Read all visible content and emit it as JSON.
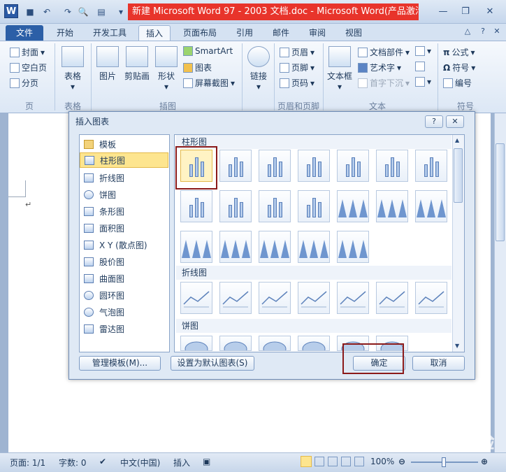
{
  "window": {
    "title": "新建 Microsoft Word 97 - 2003 文档.doc - Microsoft Word(产品激活...",
    "app_icon": "W"
  },
  "tabs": [
    "文件",
    "开始",
    "开发工具",
    "插入",
    "页面布局",
    "引用",
    "邮件",
    "审阅",
    "视图"
  ],
  "active_tab": "插入",
  "ribbon": {
    "pages": {
      "cover": "封面",
      "blank": "空白页",
      "break": "分页",
      "group": "页"
    },
    "table": {
      "label": "表格",
      "group": "表格"
    },
    "illustrations": {
      "picture": "图片",
      "clipart": "剪贴画",
      "shapes": "形状",
      "smartart": "SmartArt",
      "chart": "图表",
      "screenshot": "屏幕截图",
      "group": "插图"
    },
    "links": {
      "label": "链接"
    },
    "header_footer": {
      "header": "页眉",
      "footer": "页脚",
      "page_number": "页码",
      "group": "页眉和页脚"
    },
    "text": {
      "textbox": "文本框",
      "quickparts": "文档部件",
      "wordart": "艺术字",
      "dropcap": "首字下沉",
      "group": "文本"
    },
    "symbols": {
      "equation": "公式",
      "symbol": "符号",
      "numbering": "编号",
      "group": "符号"
    }
  },
  "dialog": {
    "title": "插入图表",
    "help": "?",
    "close": "✕",
    "categories": [
      {
        "label": "模板",
        "icon": "folder-icon"
      },
      {
        "label": "柱形图",
        "icon": "column-chart-icon"
      },
      {
        "label": "折线图",
        "icon": "line-chart-icon"
      },
      {
        "label": "饼图",
        "icon": "pie-chart-icon"
      },
      {
        "label": "条形图",
        "icon": "bar-chart-icon"
      },
      {
        "label": "面积图",
        "icon": "area-chart-icon"
      },
      {
        "label": "X Y (散点图)",
        "icon": "scatter-chart-icon"
      },
      {
        "label": "股价图",
        "icon": "stock-chart-icon"
      },
      {
        "label": "曲面图",
        "icon": "surface-chart-icon"
      },
      {
        "label": "圆环图",
        "icon": "doughnut-chart-icon"
      },
      {
        "label": "气泡图",
        "icon": "bubble-chart-icon"
      },
      {
        "label": "雷达图",
        "icon": "radar-chart-icon"
      }
    ],
    "selected_category": "柱形图",
    "sections": {
      "column": "柱形图",
      "line": "折线图",
      "pie": "饼图"
    },
    "manage_templates": "管理模板(M)...",
    "set_default": "设置为默认图表(S)",
    "ok": "确定",
    "cancel": "取消"
  },
  "status": {
    "page": "页面: 1/1",
    "words": "字数: 0",
    "language": "中文(中国)",
    "insert_mode": "插入",
    "zoom": "100%"
  },
  "watermark": "Baidu 经验"
}
